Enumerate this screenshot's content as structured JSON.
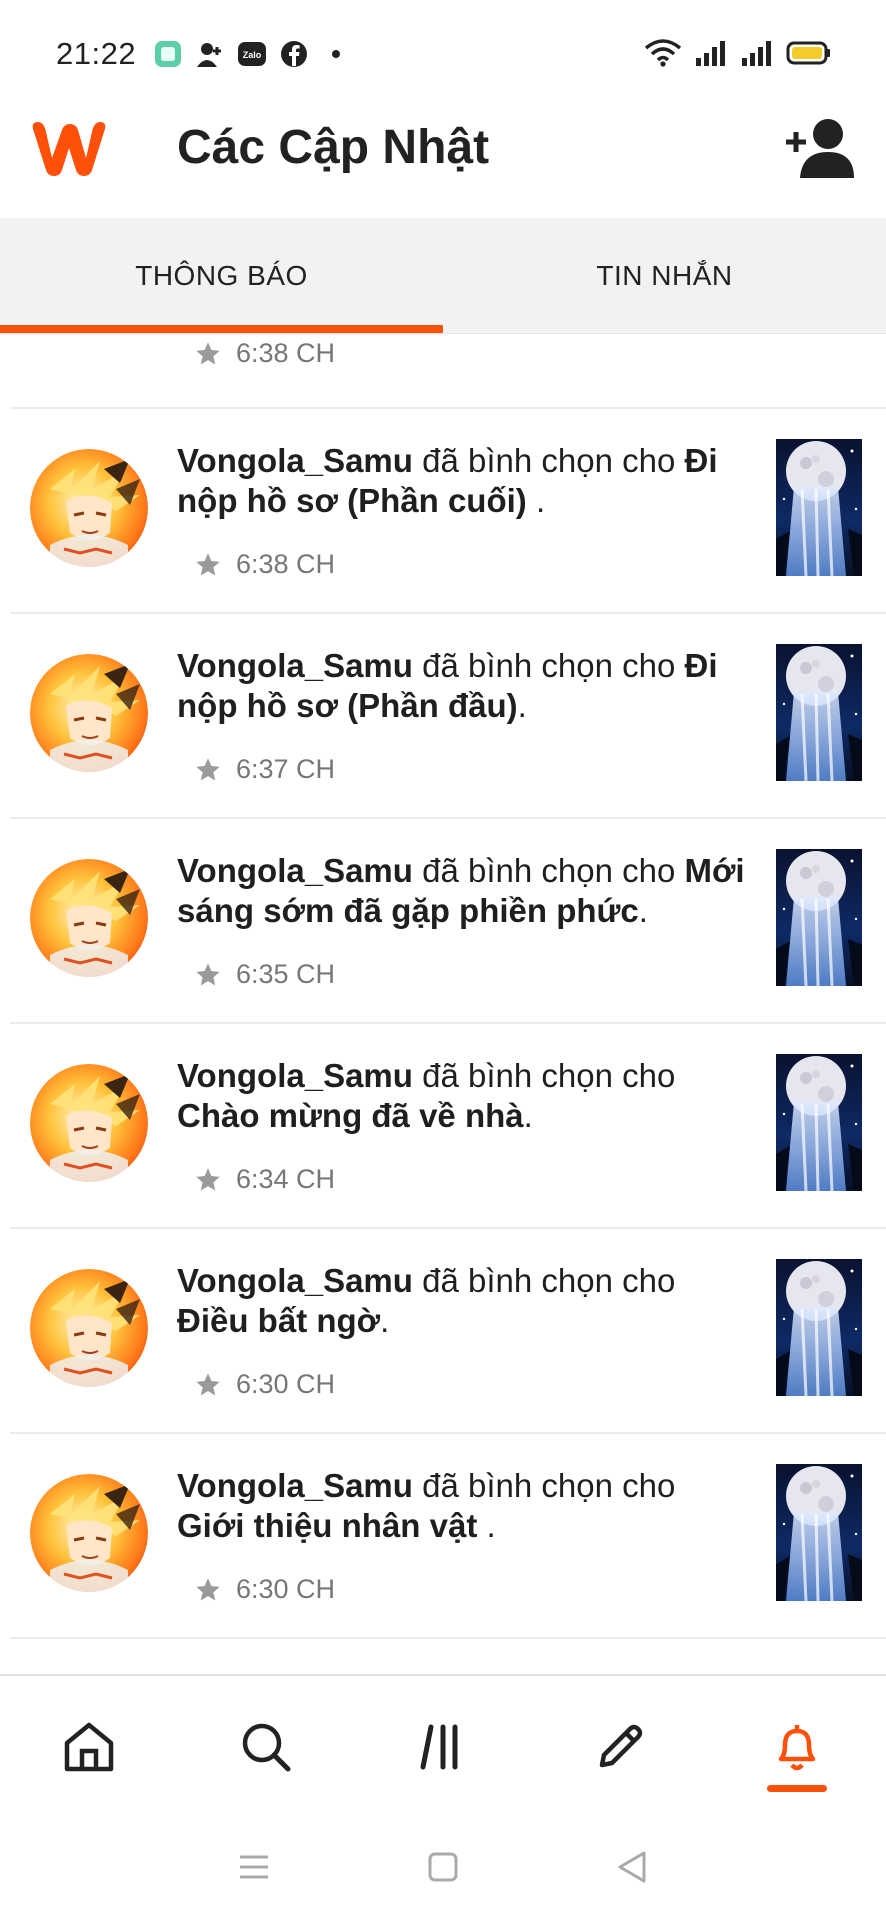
{
  "status_bar": {
    "time": "21:22",
    "apps": [
      "chat-app-icon",
      "add-contact-icon",
      "zalo-icon",
      "facebook-icon",
      "more-dot-icon"
    ],
    "zalo_label": "Zalo"
  },
  "header": {
    "title": "Các Cập Nhật",
    "brand_color": "#ff500a"
  },
  "tabs": [
    {
      "label": "THÔNG BÁO",
      "active": true
    },
    {
      "label": "TIN NHẮN",
      "active": false
    }
  ],
  "partial_item": {
    "time": "6:38 CH"
  },
  "notifications": [
    {
      "user": "Vongola_Samu",
      "action": " đã bình chọn cho ",
      "story": "Đi nộp hồ sơ (Phần cuối)",
      "suffix": " .",
      "time": "6:38 CH"
    },
    {
      "user": "Vongola_Samu",
      "action": " đã bình chọn cho ",
      "story": "Đi nộp hồ sơ (Phần đầu)",
      "suffix": ".",
      "time": "6:37 CH"
    },
    {
      "user": "Vongola_Samu",
      "action": " đã bình chọn cho ",
      "story": "Mới sáng sớm đã gặp phiền phức",
      "suffix": ".",
      "time": "6:35 CH"
    },
    {
      "user": "Vongola_Samu",
      "action": " đã bình chọn cho ",
      "story": "Chào mừng đã về nhà",
      "suffix": ".",
      "time": "6:34 CH"
    },
    {
      "user": "Vongola_Samu",
      "action": " đã bình chọn cho ",
      "story": "Điều bất ngờ",
      "suffix": ".",
      "time": "6:30 CH"
    },
    {
      "user": "Vongola_Samu",
      "action": " đã bình chọn cho ",
      "story": "Giới thiệu nhân vật",
      "suffix": " .",
      "time": "6:30 CH"
    }
  ],
  "bottom_nav": [
    {
      "icon": "home-icon",
      "active": false
    },
    {
      "icon": "search-icon",
      "active": false
    },
    {
      "icon": "library-icon",
      "active": false
    },
    {
      "icon": "write-icon",
      "active": false
    },
    {
      "icon": "notifications-bell-icon",
      "active": true
    }
  ],
  "system_nav": [
    "recents-icon",
    "home-square-icon",
    "back-triangle-icon"
  ]
}
